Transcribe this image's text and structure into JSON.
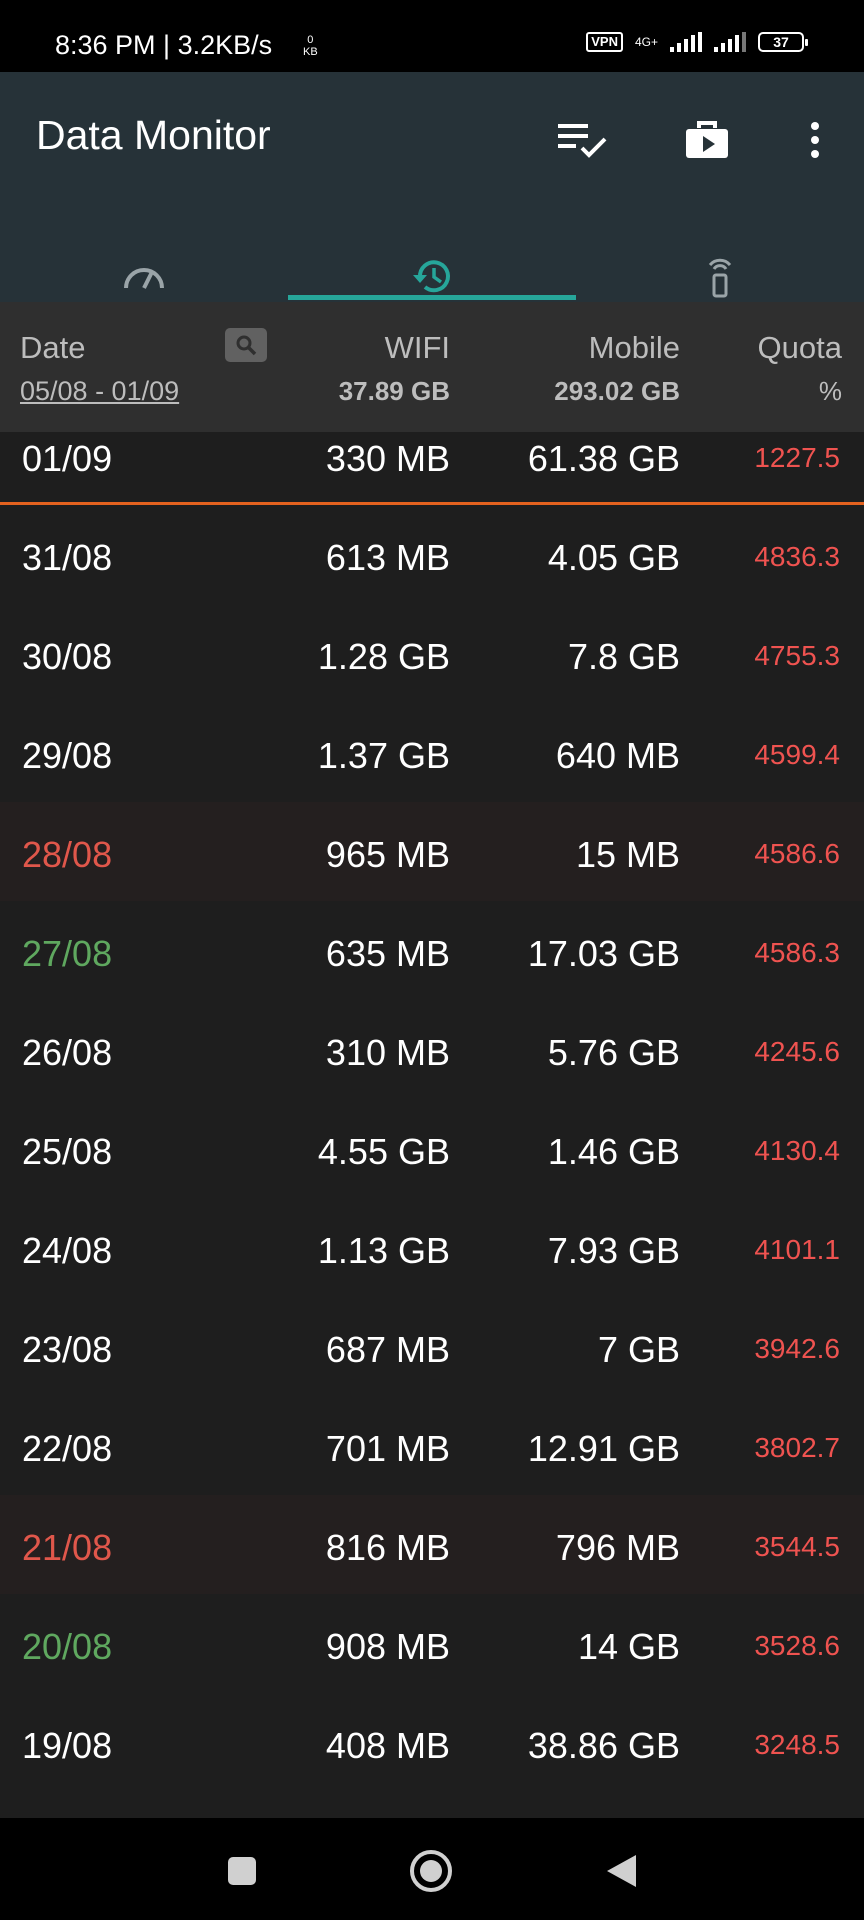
{
  "status_bar": {
    "time_speed": "8:36 PM | 3.2KB/s",
    "speed_value": "0",
    "speed_unit": "KB",
    "vpn": "VPN",
    "network": "4G+",
    "battery": "37"
  },
  "app_bar": {
    "title": "Data Monitor",
    "actions": [
      "checklist-icon",
      "toolbox-icon",
      "more-vert-icon"
    ]
  },
  "tabs": [
    {
      "icon": "speedometer-icon",
      "active": false
    },
    {
      "icon": "history-icon",
      "active": true
    },
    {
      "icon": "remote-icon",
      "active": false
    }
  ],
  "colors": {
    "accent": "#26a69a",
    "quota": "#ef5350",
    "divider": "#e4621f",
    "date_red": "#e0574b",
    "date_green": "#5fa85f"
  },
  "header": {
    "date_label": "Date",
    "date_range": "05/08 - 01/09",
    "wifi_label": "WIFI",
    "wifi_total": "37.89 GB",
    "mobile_label": "Mobile",
    "mobile_total": "293.02 GB",
    "quota_label": "Quota",
    "quota_unit": "%"
  },
  "rows": [
    {
      "date": "01/09",
      "wifi": "330 MB",
      "mobile": "61.38 GB",
      "quota": "1227.5"
    },
    {
      "date": "31/08",
      "wifi": "613 MB",
      "mobile": "4.05 GB",
      "quota": "4836.3"
    },
    {
      "date": "30/08",
      "wifi": "1.28 GB",
      "mobile": "7.8 GB",
      "quota": "4755.3"
    },
    {
      "date": "29/08",
      "wifi": "1.37 GB",
      "mobile": "640 MB",
      "quota": "4599.4"
    },
    {
      "date": "28/08",
      "wifi": "965 MB",
      "mobile": "15 MB",
      "quota": "4586.6"
    },
    {
      "date": "27/08",
      "wifi": "635 MB",
      "mobile": "17.03 GB",
      "quota": "4586.3"
    },
    {
      "date": "26/08",
      "wifi": "310 MB",
      "mobile": "5.76 GB",
      "quota": "4245.6"
    },
    {
      "date": "25/08",
      "wifi": "4.55 GB",
      "mobile": "1.46 GB",
      "quota": "4130.4"
    },
    {
      "date": "24/08",
      "wifi": "1.13 GB",
      "mobile": "7.93 GB",
      "quota": "4101.1"
    },
    {
      "date": "23/08",
      "wifi": "687 MB",
      "mobile": "7 GB",
      "quota": "3942.6"
    },
    {
      "date": "22/08",
      "wifi": "701 MB",
      "mobile": "12.91 GB",
      "quota": "3802.7"
    },
    {
      "date": "21/08",
      "wifi": "816 MB",
      "mobile": "796 MB",
      "quota": "3544.5"
    },
    {
      "date": "20/08",
      "wifi": "908 MB",
      "mobile": "14 GB",
      "quota": "3528.6"
    },
    {
      "date": "19/08",
      "wifi": "408 MB",
      "mobile": "38.86 GB",
      "quota": "3248.5"
    }
  ],
  "nav_bar": [
    "recents-icon",
    "home-icon",
    "back-icon"
  ]
}
